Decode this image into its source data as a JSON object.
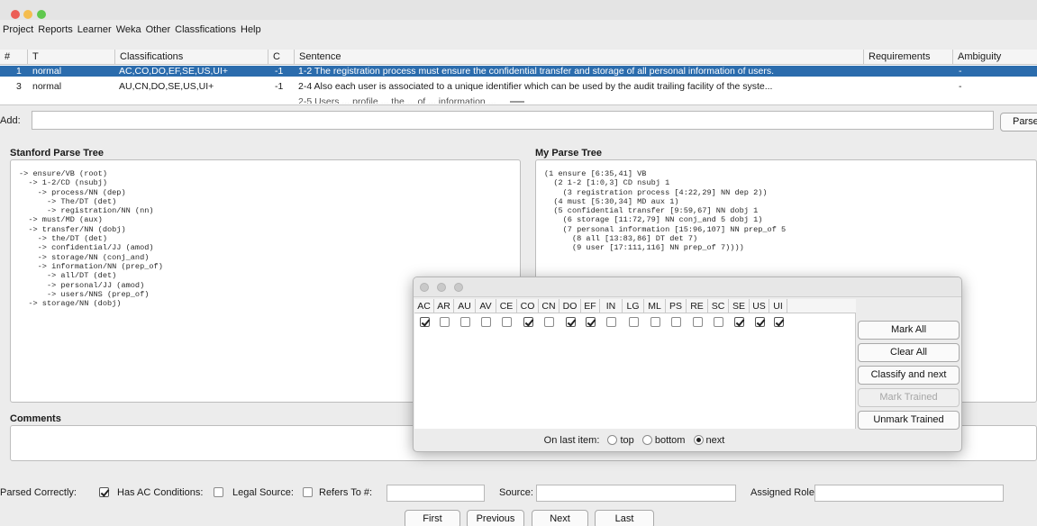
{
  "menu": [
    "Project",
    "Reports",
    "Learner",
    "Weka",
    "Other",
    "Classfications",
    "Help"
  ],
  "table": {
    "headers": [
      "#",
      "T",
      "Classifications",
      "C",
      "Sentence",
      "Requirements",
      "Ambiguity"
    ],
    "rows": [
      {
        "num": "1",
        "type": "normal",
        "classifications": "AC,CO,DO,EF,SE,US,UI+",
        "c": "-1",
        "sentence": "1-2  The registration process must ensure the confidential transfer and storage of all personal information of users.",
        "requirements": "",
        "ambiguity": "-"
      },
      {
        "num": "3",
        "type": "normal",
        "classifications": "AU,CN,DO,SE,US,UI+",
        "c": "-1",
        "sentence": "2-4  Also each user is associated to a unique identifier which can be used by the audit trailing facility of the syste...",
        "requirements": "",
        "ambiguity": "-"
      }
    ],
    "partial_row": "2-5  Users ... profile ... the ... of ... information ..."
  },
  "add": {
    "label": "Add:",
    "value": "",
    "parse_button": "Parse"
  },
  "stanford": {
    "title": "Stanford Parse Tree",
    "text": "-> ensure/VB (root)\n  -> 1-2/CD (nsubj)\n    -> process/NN (dep)\n      -> The/DT (det)\n      -> registration/NN (nn)\n  -> must/MD (aux)\n  -> transfer/NN (dobj)\n    -> the/DT (det)\n    -> confidential/JJ (amod)\n    -> storage/NN (conj_and)\n    -> information/NN (prep_of)\n      -> all/DT (det)\n      -> personal/JJ (amod)\n      -> users/NNS (prep_of)\n  -> storage/NN (dobj)"
  },
  "myparse": {
    "title": "My Parse Tree",
    "text": "(1 ensure [6:35,41] VB\n  (2 1-2 [1:0,3] CD nsubj 1\n    (3 registration process [4:22,29] NN dep 2))\n  (4 must [5:30,34] MD aux 1)\n  (5 confidential transfer [9:59,67] NN dobj 1\n    (6 storage [11:72,79] NN conj_and 5 dobj 1)\n    (7 personal information [15:96,107] NN prep_of 5\n      (8 all [13:83,86] DT det 7)\n      (9 user [17:111,116] NN prep_of 7))))"
  },
  "comments": {
    "title": "Comments",
    "value": ""
  },
  "bottom": {
    "parsed_correctly": "Parsed Correctly:",
    "has_ac": "Has AC Conditions:",
    "legal_source": "Legal Source:",
    "refers_to": "Refers To #:",
    "source": "Source:",
    "assigned_role": "Assigned Role:"
  },
  "checks": {
    "parsed_correctly": true,
    "has_ac": false,
    "legal_source": false
  },
  "nav": {
    "first": "First",
    "previous": "Previous",
    "next": "Next",
    "last": "Last"
  },
  "dialog": {
    "codes": [
      "AC",
      "AR",
      "AU",
      "AV",
      "CE",
      "CO",
      "CN",
      "DO",
      "EF",
      "IN",
      "LG",
      "ML",
      "PS",
      "RE",
      "SC",
      "SE",
      "US",
      "UI"
    ],
    "checked": [
      true,
      false,
      false,
      false,
      false,
      true,
      false,
      true,
      true,
      false,
      false,
      false,
      false,
      false,
      false,
      true,
      true,
      true
    ],
    "buttons": {
      "mark_all": "Mark All",
      "clear_all": "Clear All",
      "classify_next": "Classify and next",
      "mark_trained": "Mark Trained",
      "unmark_trained": "Unmark Trained"
    },
    "on_last_item": "On last item:",
    "radio_top": "top",
    "radio_bottom": "bottom",
    "radio_next": "next",
    "selected_radio": "next"
  },
  "colors": {
    "selection": "#2b6cad",
    "close": "#ec5e56",
    "minimize": "#f4bd4f",
    "zoom": "#5fc84e"
  }
}
